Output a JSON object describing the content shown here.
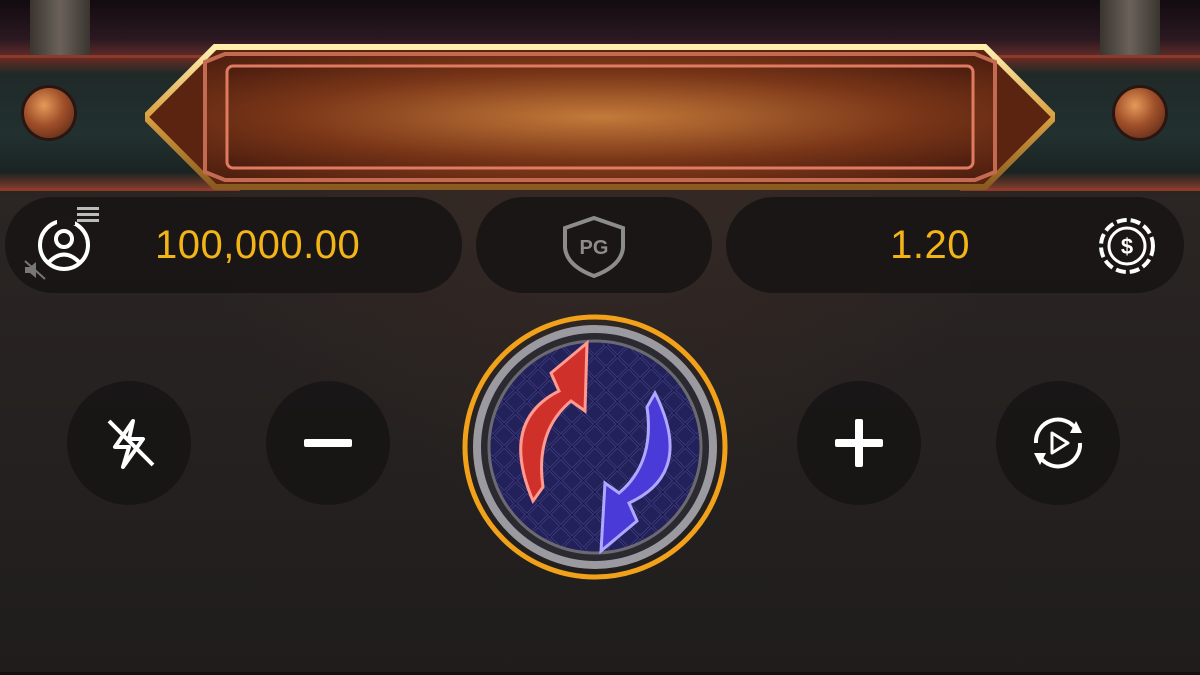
{
  "wallet": {
    "balance": "100,000.00",
    "balance_icon": "user-wallet-icon",
    "menu_icon": "menu-icon",
    "sound_icon": "sound-muted-icon"
  },
  "brand": {
    "logo_text": "PG",
    "logo_icon": "pg-shield-logo"
  },
  "bet": {
    "amount": "1.20",
    "bet_icon": "coin-dollar-icon"
  },
  "controls": {
    "turbo": "turbo-off-icon",
    "decrease": "minus-icon",
    "spin": "spin-icon",
    "increase": "plus-icon",
    "autoplay": "autoplay-icon"
  },
  "colors": {
    "value_text": "#f3b418",
    "spin_ring": "#f2a21a",
    "arrow_red": "#d0302a",
    "arrow_blue": "#4a3ad8",
    "pill_bg": "#141212"
  }
}
